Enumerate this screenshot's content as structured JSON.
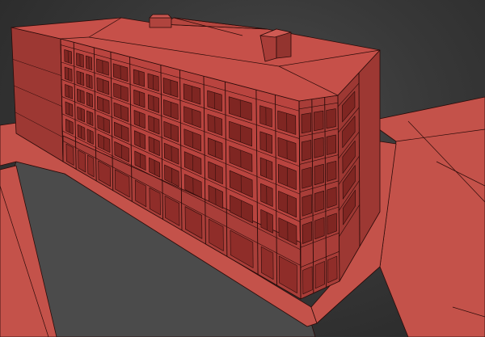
{
  "scene": {
    "colors": {
      "background": "#3a3a3a",
      "ground": "#c4524a",
      "road": "#4b4b4b",
      "roof": "#c65049",
      "facade_front": "#b9443f",
      "facade_corner": "#a83d38",
      "facade_side": "#9d3833",
      "window": "#7f2622",
      "wire": "#2a0b09"
    }
  }
}
